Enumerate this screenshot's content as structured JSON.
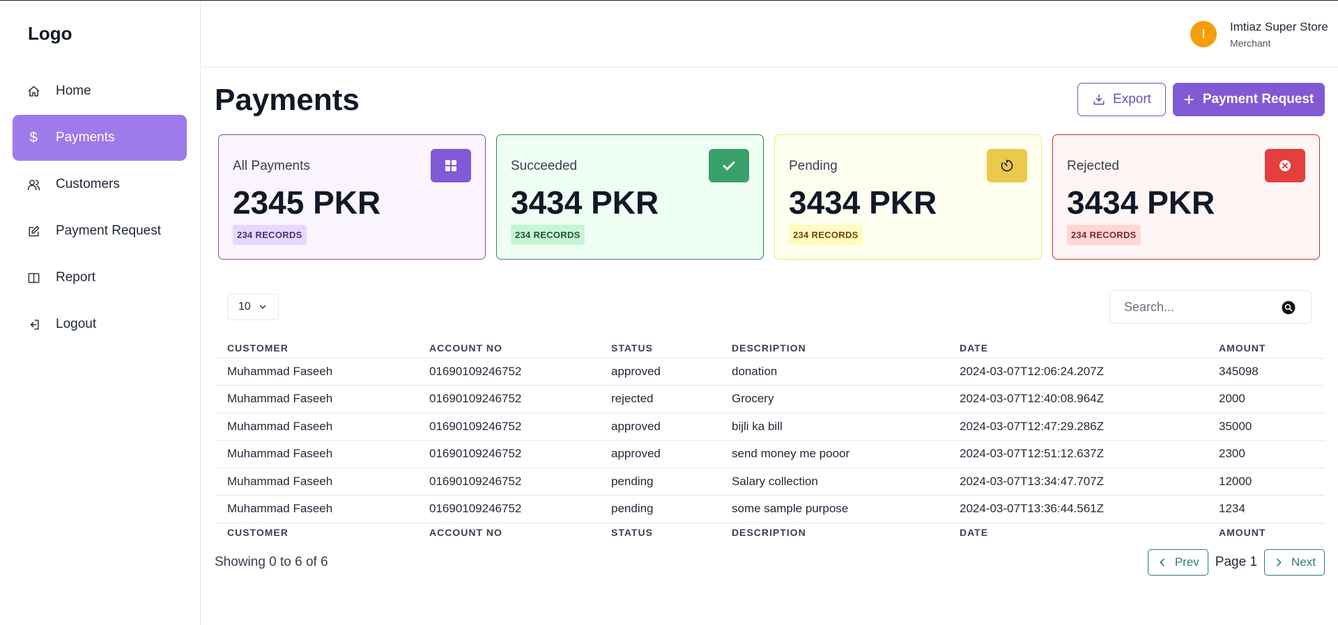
{
  "sidebar": {
    "logo": "Logo",
    "items": [
      {
        "label": "Home",
        "icon": "home-icon"
      },
      {
        "label": "Payments",
        "icon": "dollar-icon",
        "active": true
      },
      {
        "label": "Customers",
        "icon": "users-icon"
      },
      {
        "label": "Payment Request",
        "icon": "edit-icon"
      },
      {
        "label": "Report",
        "icon": "book-icon"
      },
      {
        "label": "Logout",
        "icon": "logout-icon"
      }
    ]
  },
  "header": {
    "avatar_initial": "I",
    "user_name": "Imtiaz Super Store",
    "user_role": "Merchant"
  },
  "page": {
    "title": "Payments",
    "export_label": "Export",
    "request_label": "Payment Request"
  },
  "cards": [
    {
      "label": "All Payments",
      "value": "2345 PKR",
      "badge": "234 RECORDS",
      "icon": "grid-icon"
    },
    {
      "label": "Succeeded",
      "value": "3434 PKR",
      "badge": "234 RECORDS",
      "icon": "check-icon"
    },
    {
      "label": "Pending",
      "value": "3434 PKR",
      "badge": "234 RECORDS",
      "icon": "timer-icon"
    },
    {
      "label": "Rejected",
      "value": "3434 PKR",
      "badge": "234 RECORDS",
      "icon": "x-circle-icon"
    }
  ],
  "controls": {
    "page_size": "10",
    "search_placeholder": "Search..."
  },
  "table": {
    "columns": [
      "CUSTOMER",
      "ACCOUNT NO",
      "STATUS",
      "DESCRIPTION",
      "DATE",
      "AMOUNT"
    ],
    "rows": [
      [
        "Muhammad Faseeh",
        "01690109246752",
        "approved",
        "donation",
        "2024-03-07T12:06:24.207Z",
        "345098"
      ],
      [
        "Muhammad Faseeh",
        "01690109246752",
        "rejected",
        "Grocery",
        "2024-03-07T12:40:08.964Z",
        "2000"
      ],
      [
        "Muhammad Faseeh",
        "01690109246752",
        "approved",
        "bijli ka bill",
        "2024-03-07T12:47:29.286Z",
        "35000"
      ],
      [
        "Muhammad Faseeh",
        "01690109246752",
        "approved",
        "send money me pooor",
        "2024-03-07T12:51:12.637Z",
        "2300"
      ],
      [
        "Muhammad Faseeh",
        "01690109246752",
        "pending",
        "Salary collection",
        "2024-03-07T13:34:47.707Z",
        "12000"
      ],
      [
        "Muhammad Faseeh",
        "01690109246752",
        "pending",
        "some sample purpose",
        "2024-03-07T13:36:44.561Z",
        "1234"
      ]
    ]
  },
  "pagination": {
    "showing": "Showing 0 to 6 of 6",
    "prev": "Prev",
    "page": "Page 1",
    "next": "Next"
  },
  "colors": {
    "accent": "#805ad5",
    "sidebar_active": "#9f7aea",
    "success": "#38a169",
    "pending": "#ecc94b",
    "rejected": "#e53e3e",
    "pager": "#2c7a7b",
    "avatar": "#f59e0b"
  }
}
